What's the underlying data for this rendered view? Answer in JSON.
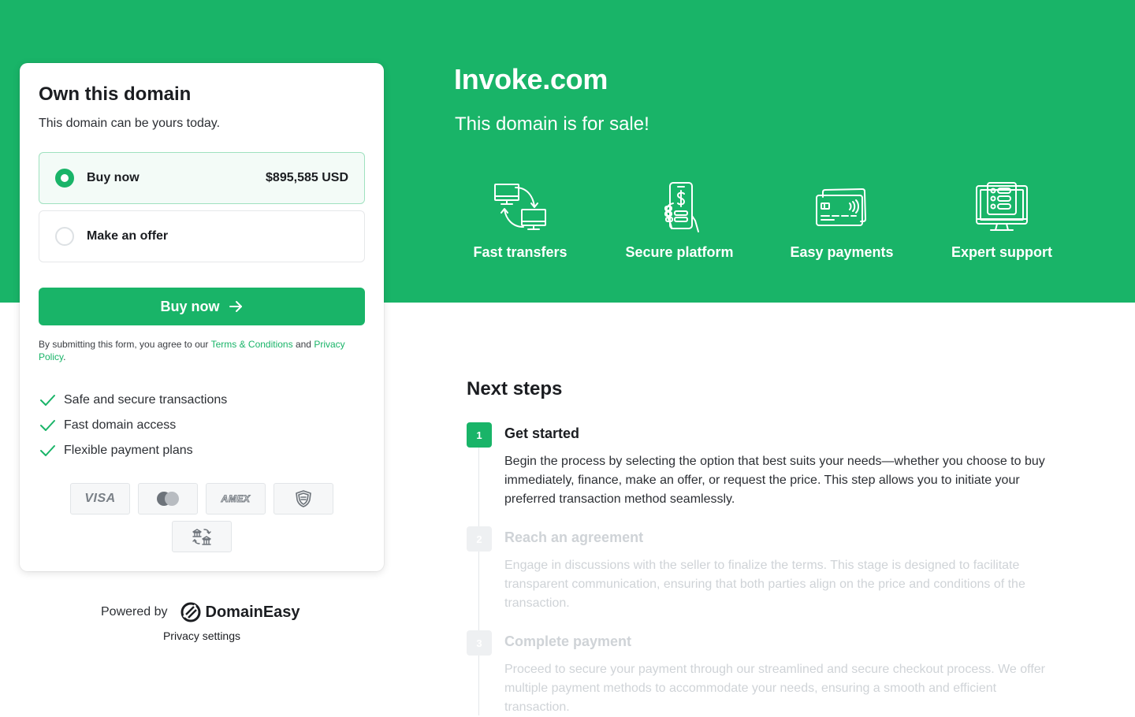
{
  "hero": {
    "domain": "Invoke.com",
    "tagline": "This domain is for sale!",
    "features": [
      {
        "icon": "transfer-icon",
        "label": "Fast transfers"
      },
      {
        "icon": "secure-phone-icon",
        "label": "Secure platform"
      },
      {
        "icon": "credit-card-icon",
        "label": "Easy payments"
      },
      {
        "icon": "support-monitor-icon",
        "label": "Expert support"
      }
    ]
  },
  "card": {
    "title": "Own this domain",
    "subtitle": "This domain can be yours today.",
    "options": [
      {
        "label": "Buy now",
        "price": "$895,585 USD",
        "selected": true
      },
      {
        "label": "Make an offer",
        "price": "",
        "selected": false
      }
    ],
    "button_label": "Buy now",
    "legal": {
      "prefix": "By submitting this form, you agree to our ",
      "terms": "Terms & Conditions",
      "middle": " and ",
      "privacy": "Privacy Policy",
      "suffix": "."
    },
    "benefits": [
      "Safe and secure transactions",
      "Fast domain access",
      "Flexible payment plans"
    ],
    "payment_methods": [
      {
        "name": "visa",
        "text": "VISA"
      },
      {
        "name": "mastercard",
        "text": ""
      },
      {
        "name": "amex",
        "text": "AMEX"
      },
      {
        "name": "escrow",
        "text": ""
      },
      {
        "name": "bank-transfer",
        "text": ""
      }
    ]
  },
  "footer": {
    "powered_by": "Powered by",
    "brand": "DomainEasy",
    "privacy_settings": "Privacy settings"
  },
  "next_steps": {
    "title": "Next steps",
    "steps": [
      {
        "num": "1",
        "title": "Get started",
        "desc": "Begin the process by selecting the option that best suits your needs—whether you choose to buy immediately, finance, make an offer, or request the price. This step allows you to initiate your preferred transaction method seamlessly.",
        "active": true
      },
      {
        "num": "2",
        "title": "Reach an agreement",
        "desc": "Engage in discussions with the seller to finalize the terms. This stage is designed to facilitate transparent communication, ensuring that both parties align on the price and conditions of the transaction.",
        "active": false
      },
      {
        "num": "3",
        "title": "Complete payment",
        "desc": "Proceed to secure your payment through our streamlined and secure checkout process. We offer multiple payment methods to accommodate your needs, ensuring a smooth and efficient transaction.",
        "active": false
      }
    ]
  },
  "colors": {
    "brand_green": "#19b468",
    "text_dark": "#1b1d21",
    "dim_text": "#cfd3d7"
  }
}
